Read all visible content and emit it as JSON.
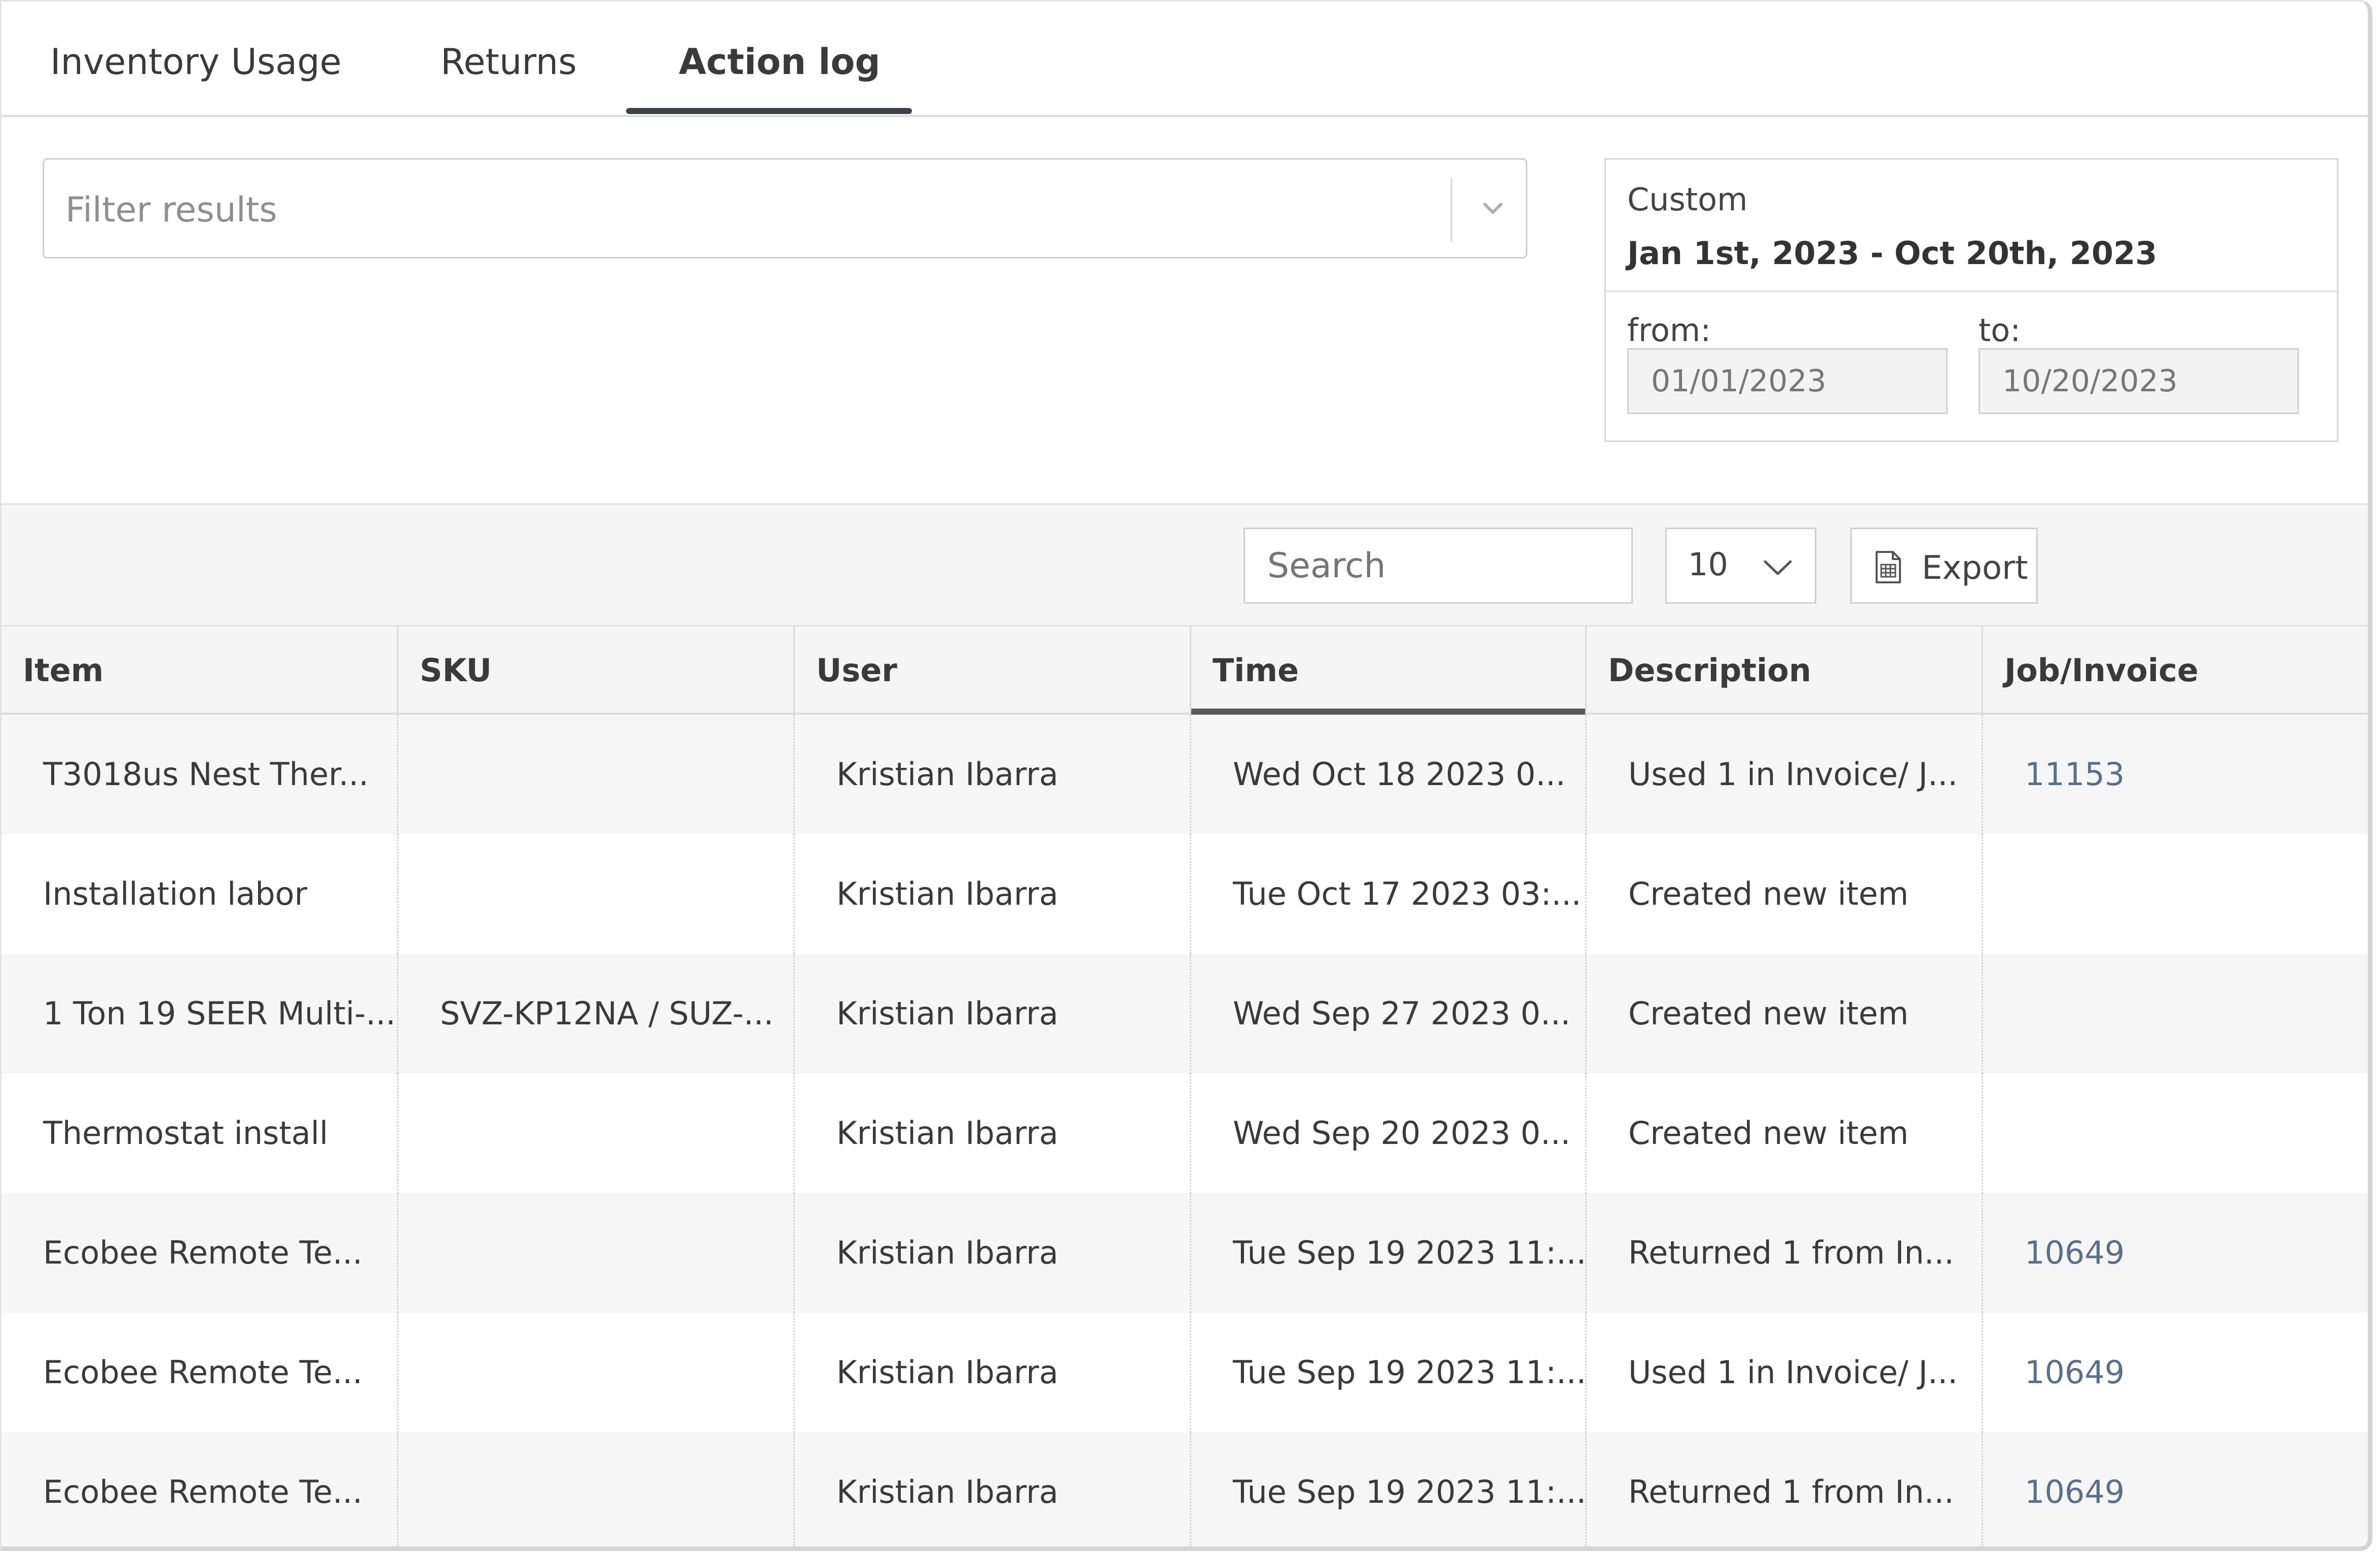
{
  "tabs": [
    {
      "label": "Inventory Usage",
      "active": false
    },
    {
      "label": "Returns",
      "active": false
    },
    {
      "label": "Action log",
      "active": true
    }
  ],
  "filter": {
    "placeholder": "Filter results",
    "icon": "chevron-down-icon"
  },
  "date_range": {
    "label": "Custom",
    "range": "Jan 1st, 2023 - Oct 20th, 2023",
    "from_label": "from:",
    "from_value": "01/01/2023",
    "to_label": "to:",
    "to_value": "10/20/2023"
  },
  "toolbar": {
    "search_placeholder": "Search",
    "page_size": "10",
    "export_label": "Export",
    "export_icon": "spreadsheet-icon"
  },
  "table": {
    "columns": [
      "Item",
      "SKU",
      "User",
      "Time",
      "Description",
      "Job/Invoice"
    ],
    "sorted_column": "Time",
    "rows": [
      {
        "item": "T3018us Nest Ther...",
        "sku": "",
        "user": "Kristian Ibarra",
        "time": "Wed Oct 18 2023 0...",
        "description": "Used 1 in Invoice/ J...",
        "job": "11153"
      },
      {
        "item": "Installation labor",
        "sku": "",
        "user": "Kristian Ibarra",
        "time": "Tue Oct 17 2023 03:...",
        "description": "Created new item",
        "job": ""
      },
      {
        "item": "1 Ton 19 SEER Multi-...",
        "sku": "SVZ-KP12NA / SUZ-...",
        "user": "Kristian Ibarra",
        "time": "Wed Sep 27 2023 0...",
        "description": "Created new item",
        "job": ""
      },
      {
        "item": "Thermostat install",
        "sku": "",
        "user": "Kristian Ibarra",
        "time": "Wed Sep 20 2023 0...",
        "description": "Created new item",
        "job": ""
      },
      {
        "item": "Ecobee Remote Te...",
        "sku": "",
        "user": "Kristian Ibarra",
        "time": "Tue Sep 19 2023 11:...",
        "description": "Returned 1 from In...",
        "job": "10649"
      },
      {
        "item": "Ecobee Remote Te...",
        "sku": "",
        "user": "Kristian Ibarra",
        "time": "Tue Sep 19 2023 11:...",
        "description": "Used 1 in Invoice/ J...",
        "job": "10649"
      },
      {
        "item": "Ecobee Remote Te...",
        "sku": "",
        "user": "Kristian Ibarra",
        "time": "Tue Sep 19 2023 11:...",
        "description": "Returned 1 from In...",
        "job": "10649"
      }
    ]
  },
  "colors": {
    "link": "#5a6f8c",
    "active_tab_underline": "#3e4347",
    "row_alt": "#f6f6f6"
  }
}
